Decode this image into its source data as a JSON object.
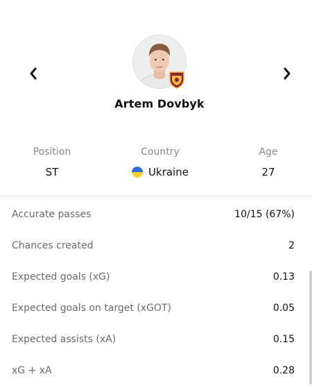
{
  "navigation": {
    "prev_icon": "chevron-left-icon",
    "next_icon": "chevron-right-icon"
  },
  "player": {
    "name": "Artem Dovbyk",
    "avatar_icon": "player-photo",
    "club_badge_icon": "as-roma-badge-icon"
  },
  "info": {
    "position_label": "Position",
    "position_value": "ST",
    "country_label": "Country",
    "country_value": "Ukraine",
    "country_flag_icon": "ukraine-flag-icon",
    "age_label": "Age",
    "age_value": "27"
  },
  "colors": {
    "text_primary": "#111111",
    "text_secondary": "#6b6b6b",
    "label_muted": "#8a8a8a",
    "flag_blue": "#2f6fd6",
    "flag_yellow": "#f7d130",
    "roma_red": "#8e1f2f",
    "roma_gold": "#f0bc42"
  },
  "stats": [
    {
      "label": "Accurate passes",
      "value": "10/15 (67%)"
    },
    {
      "label": "Chances created",
      "value": "2"
    },
    {
      "label": "Expected goals (xG)",
      "value": "0.13"
    },
    {
      "label": "Expected goals on target (xGOT)",
      "value": "0.05"
    },
    {
      "label": "Expected assists (xA)",
      "value": "0.15"
    },
    {
      "label": "xG + xA",
      "value": "0.28"
    }
  ]
}
